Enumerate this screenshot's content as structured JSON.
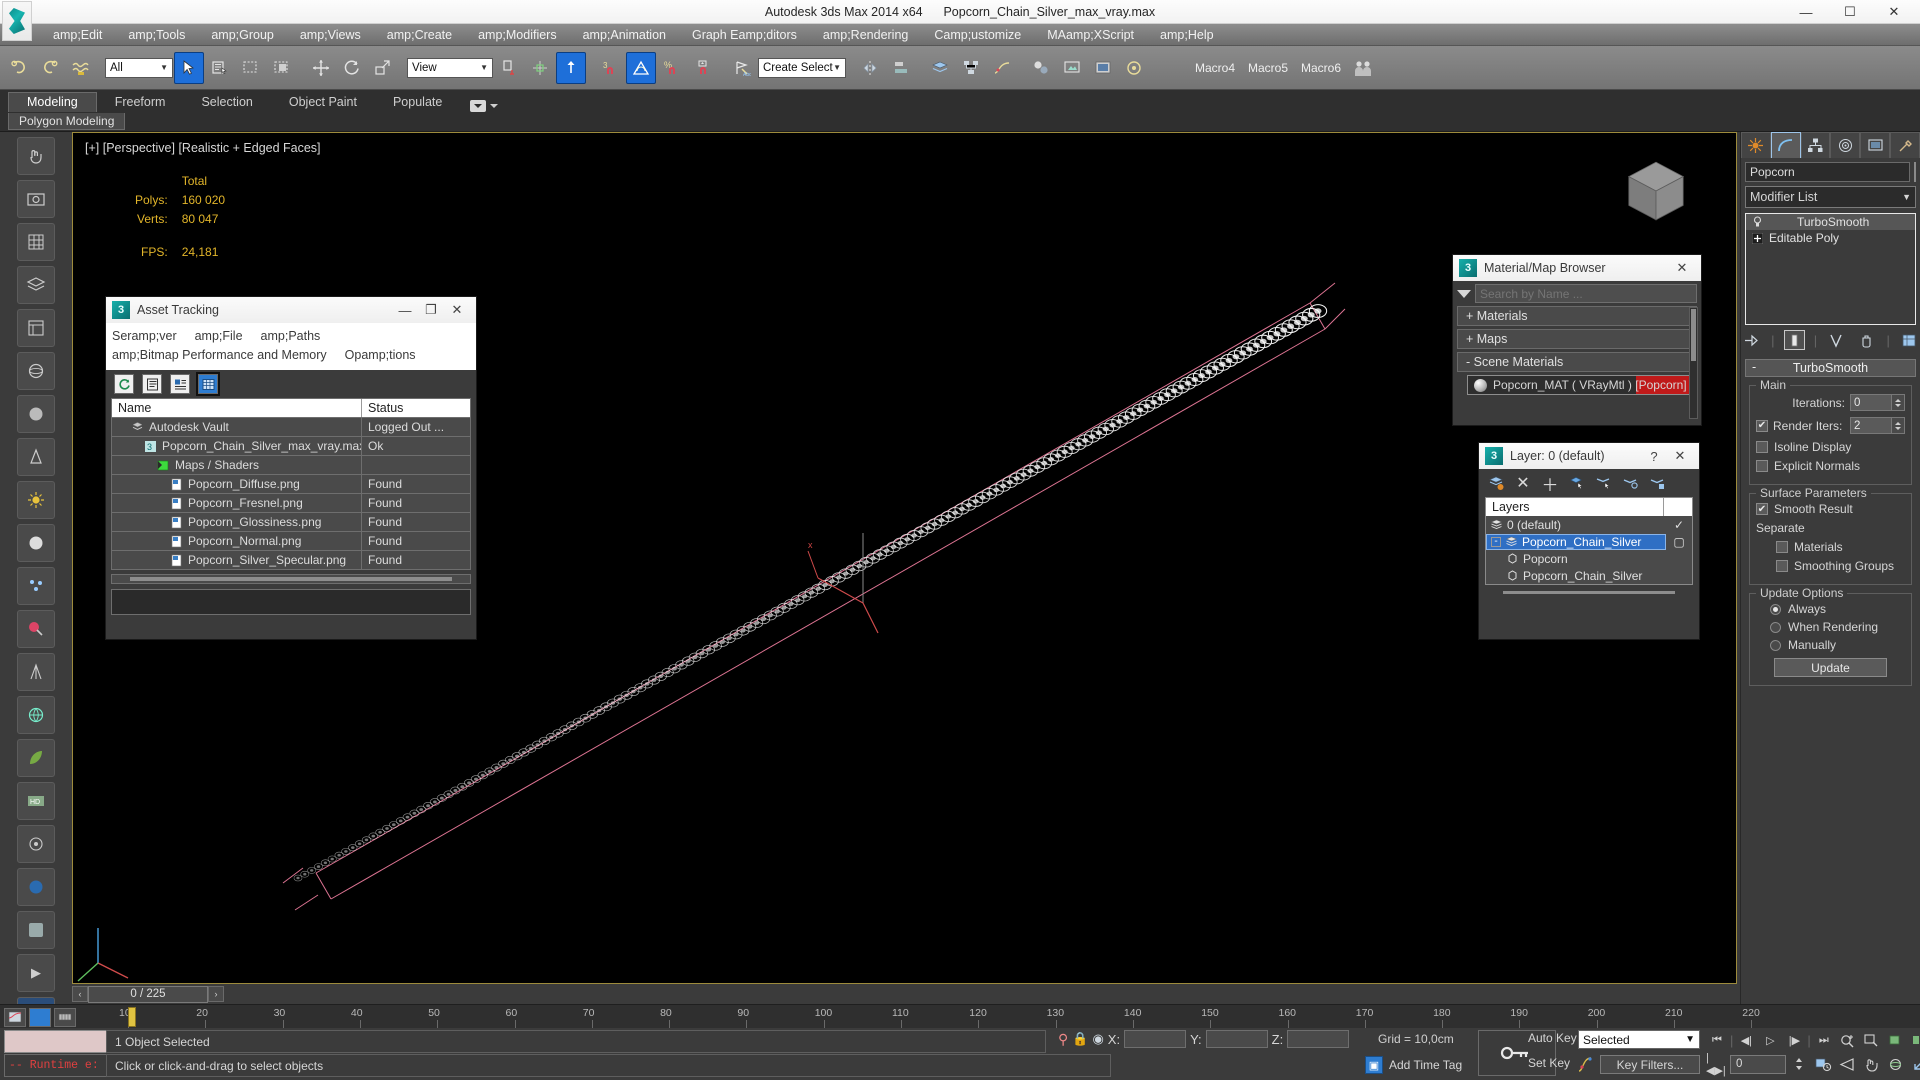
{
  "window": {
    "app_title": "Autodesk 3ds Max  2014 x64",
    "file_title": "Popcorn_Chain_Silver_max_vray.max",
    "minimize": "—",
    "maximize": "☐",
    "close": "✕",
    "logo_icon": "3dsmax-logo-icon"
  },
  "menu": {
    "items": [
      "amp;Edit",
      "amp;Tools",
      "amp;Group",
      "amp;Views",
      "amp;Create",
      "amp;Modifiers",
      "amp;Animation",
      "Graph Eamp;ditors",
      "amp;Rendering",
      "Camp;ustomize",
      "MAamp;XScript",
      "amp;Help"
    ]
  },
  "toolbar": {
    "selection_filter": "All",
    "reference_coord": "View",
    "named_selection_set": "Create Selection Se",
    "macro_buttons": [
      "Macro4",
      "Macro5",
      "Macro6"
    ],
    "icons": [
      "undo-icon",
      "redo-icon",
      "select-link-icon",
      "unlink-icon",
      "bind-spacewarp-icon",
      "select-object-icon",
      "select-by-name-icon",
      "rectangular-region-icon",
      "window-crossing-icon",
      "select-move-icon",
      "select-rotate-icon",
      "select-scale-icon",
      "mirror-icon",
      "align-icon",
      "snaps-toggle-icon",
      "angle-snap-icon",
      "percent-snap-icon",
      "spinner-snap-icon",
      "named-selection-icon"
    ]
  },
  "ribbon": {
    "tabs": [
      "Modeling",
      "Freeform",
      "Selection",
      "Object Paint",
      "Populate"
    ],
    "active_tab": "Modeling",
    "panel_label": "Polygon Modeling"
  },
  "viewport": {
    "label": "[+] [Perspective] [Realistic + Edged Faces]",
    "stats_header": "Total",
    "stats": [
      {
        "key": "Polys:",
        "value": "160 020"
      },
      {
        "key": "Verts:",
        "value": "80 047"
      }
    ],
    "fps_label": "FPS:",
    "fps_value": "24,181",
    "viewcube_label": "viewcube"
  },
  "asset_tracking": {
    "title": "Asset Tracking",
    "minimize": "—",
    "maximize": "❐",
    "close": "✕",
    "menu_row1": [
      "Seramp;ver",
      "amp;File",
      "amp;Paths"
    ],
    "menu_row2": [
      "amp;Bitmap Performance and Memory",
      "Opamp;tions"
    ],
    "tools": [
      "refresh-icon",
      "list-view-icon",
      "details-view-icon",
      "grid-view-icon"
    ],
    "columns": [
      "Name",
      "Status"
    ],
    "rows": [
      {
        "name": "Autodesk Vault",
        "status": "Logged Out ...",
        "indent": 1,
        "icon": "vault-icon"
      },
      {
        "name": "Popcorn_Chain_Silver_max_vray.max",
        "status": "Ok",
        "indent": 2,
        "icon": "max-file-icon"
      },
      {
        "name": "Maps / Shaders",
        "status": "",
        "indent": 3,
        "icon": "maps-shaders-icon"
      },
      {
        "name": "Popcorn_Diffuse.png",
        "status": "Found",
        "indent": 4,
        "icon": "bitmap-icon"
      },
      {
        "name": "Popcorn_Fresnel.png",
        "status": "Found",
        "indent": 4,
        "icon": "bitmap-icon"
      },
      {
        "name": "Popcorn_Glossiness.png",
        "status": "Found",
        "indent": 4,
        "icon": "bitmap-icon"
      },
      {
        "name": "Popcorn_Normal.png",
        "status": "Found",
        "indent": 4,
        "icon": "bitmap-icon"
      },
      {
        "name": "Popcorn_Silver_Specular.png",
        "status": "Found",
        "indent": 4,
        "icon": "bitmap-icon"
      }
    ]
  },
  "material_browser": {
    "title": "Material/Map Browser",
    "close": "✕",
    "search_placeholder": "Search by Name ...",
    "search_value": "",
    "groups": [
      {
        "label": "+ Materials",
        "expanded": false
      },
      {
        "label": "+ Maps",
        "expanded": false
      },
      {
        "label": "- Scene Materials",
        "expanded": true
      }
    ],
    "scene_material": "Popcorn_MAT  ( VRayMtl )  [Popcorn]",
    "highlight_color": "#c01a1a"
  },
  "layer_dialog": {
    "title": "Layer: 0 (default)",
    "help": "?",
    "close": "✕",
    "tools": [
      "create-layer-icon",
      "delete-layer-icon",
      "add-selection-icon",
      "select-objects-icon",
      "select-highlighted-icon",
      "highlight-selected-icon",
      "layer-properties-icon"
    ],
    "column_header": "Layers",
    "rows": [
      {
        "name": "0 (default)",
        "indent": 1,
        "selected": false,
        "mark": "✓",
        "icon": "layer-icon"
      },
      {
        "name": "Popcorn_Chain_Silver",
        "indent": 1,
        "selected": true,
        "mark": "▢",
        "icon": "layer-icon",
        "expander": "-"
      },
      {
        "name": "Popcorn",
        "indent": 2,
        "selected": false,
        "mark": "",
        "icon": "object-icon"
      },
      {
        "name": "Popcorn_Chain_Silver",
        "indent": 2,
        "selected": false,
        "mark": "",
        "icon": "object-icon"
      }
    ]
  },
  "command_panel": {
    "tabs": [
      "create-tab",
      "modify-tab",
      "hierarchy-tab",
      "motion-tab",
      "display-tab",
      "utilities-tab"
    ],
    "active_tab_index": 1,
    "object_name": "Popcorn",
    "modifier_list_label": "Modifier List",
    "stack": [
      {
        "label": "TurboSmooth",
        "selected": true,
        "icon": "lightbulb-icon"
      },
      {
        "label": "Editable Poly",
        "selected": false,
        "icon": "plus-box-icon"
      }
    ],
    "stack_tools": [
      "pin-stack-icon",
      "show-end-result-icon",
      "make-unique-icon",
      "remove-modifier-icon",
      "configure-sets-icon"
    ],
    "rollup": {
      "title": "TurboSmooth",
      "collapsed_marker": "-",
      "groups": [
        {
          "legend": "Main",
          "fields": [
            {
              "type": "spinner",
              "label": "Iterations:",
              "value": "0"
            },
            {
              "type": "check_spinner",
              "label": "Render Iters:",
              "value": "2",
              "checked": true
            },
            {
              "type": "checkbox",
              "label": "Isoline Display",
              "checked": false
            },
            {
              "type": "checkbox",
              "label": "Explicit Normals",
              "checked": false
            }
          ]
        },
        {
          "legend": "Surface Parameters",
          "fields": [
            {
              "type": "checkbox",
              "label": "Smooth Result",
              "checked": true
            },
            {
              "type": "text",
              "label": "Separate"
            },
            {
              "type": "checkbox",
              "label": "Materials",
              "checked": false,
              "sub": true
            },
            {
              "type": "checkbox",
              "label": "Smoothing Groups",
              "checked": false,
              "sub": true
            }
          ]
        },
        {
          "legend": "Update Options",
          "fields": [
            {
              "type": "radio",
              "label": "Always",
              "checked": true
            },
            {
              "type": "radio",
              "label": "When Rendering",
              "checked": false
            },
            {
              "type": "radio",
              "label": "Manually",
              "checked": false
            },
            {
              "type": "button",
              "label": "Update"
            }
          ]
        }
      ]
    }
  },
  "timeline": {
    "current_frame_label": "0 / 225",
    "prev_arrow": "‹",
    "next_arrow": "›",
    "ruler_ticks": [
      "10",
      "20",
      "30",
      "40",
      "50",
      "60",
      "70",
      "80",
      "90",
      "100",
      "110",
      "120",
      "130",
      "140",
      "150",
      "160",
      "170",
      "180",
      "190",
      "200",
      "210",
      "220"
    ]
  },
  "status_bar": {
    "selection_text": "1 Object Selected",
    "prompt_text": "Click or click-and-drag to select objects",
    "maxscript_log": "-- Runtime e:",
    "coord_x_label": "X:",
    "coord_y_label": "Y:",
    "coord_z_label": "Z:",
    "coord_x_value": "",
    "coord_y_value": "",
    "coord_z_value": "",
    "grid_label": "Grid = 10,0cm",
    "add_time_tag": "Add Time Tag",
    "auto_key": "Auto Key",
    "set_key": "Set Key",
    "key_mode_selected": "Selected",
    "key_filters": "Key Filters...",
    "frame_value": "0",
    "lock_icon": "lock-selection-icon",
    "pin_icon": "pin-stack-icon",
    "abs_rel_icon": "absolute-relative-icon",
    "key_icon": "key-icon"
  }
}
